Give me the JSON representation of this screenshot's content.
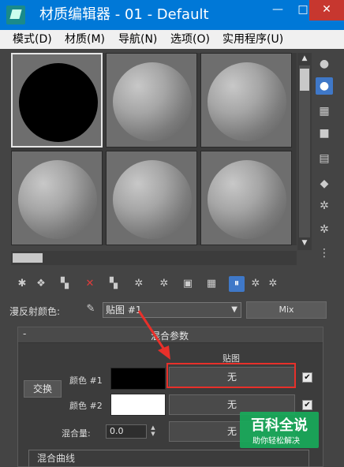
{
  "window": {
    "title": "材质编辑器 - 01 - Default",
    "minimize": "—",
    "maximize": "□",
    "close": "✕"
  },
  "menu": [
    {
      "label": "模式(D)"
    },
    {
      "label": "材质(M)"
    },
    {
      "label": "导航(N)"
    },
    {
      "label": "选项(O)"
    },
    {
      "label": "实用程序(U)"
    }
  ],
  "sample_slots": [
    {
      "material": "black",
      "selected": true
    },
    {
      "material": "gray"
    },
    {
      "material": "gray"
    },
    {
      "material": "gray"
    },
    {
      "material": "gray"
    },
    {
      "material": "gray"
    }
  ],
  "side_tools": [
    "sample-type-icon",
    "backlight-icon",
    "background-pattern-icon",
    "sample-uv-tiling-icon",
    "video-color-check-icon",
    "make-preview-icon",
    "options-icon",
    "select-by-material-icon",
    "material-map-navigator-icon"
  ],
  "toolbar_tools": [
    "get-material-icon",
    "put-to-scene-icon",
    "assign-to-selection-icon",
    "reset-map-icon",
    "copy-material-icon",
    "make-unique-icon",
    "put-to-library-icon",
    "material-id-channel-icon",
    "show-shaded-in-viewport-icon",
    "show-end-result-icon",
    "go-to-parent-icon",
    "go-forward-to-sibling-icon"
  ],
  "diffuse": {
    "label": "漫反射颜色:",
    "map_value": "贴图 #1",
    "type_button": "Mix"
  },
  "mix_params": {
    "toggle": "-",
    "title": "混合参数",
    "map_header": "贴图",
    "swap_label": "交换",
    "color1": {
      "label": "颜色 #1",
      "swatch": "#000000",
      "map": "无",
      "checked": "✔"
    },
    "color2": {
      "label": "颜色 #2",
      "swatch": "#ffffff",
      "map": "无",
      "checked": "✔"
    },
    "mix_amount": {
      "label": "混合量:",
      "value": "0.0",
      "map": "无"
    },
    "curve_group_title": "混合曲线"
  },
  "watermark": {
    "main": "百科全说",
    "sub": "助你轻松解决"
  },
  "colors": {
    "highlight": "#e8302a",
    "titlebar": "#0078d7",
    "active_tool": "#3f78c8"
  }
}
